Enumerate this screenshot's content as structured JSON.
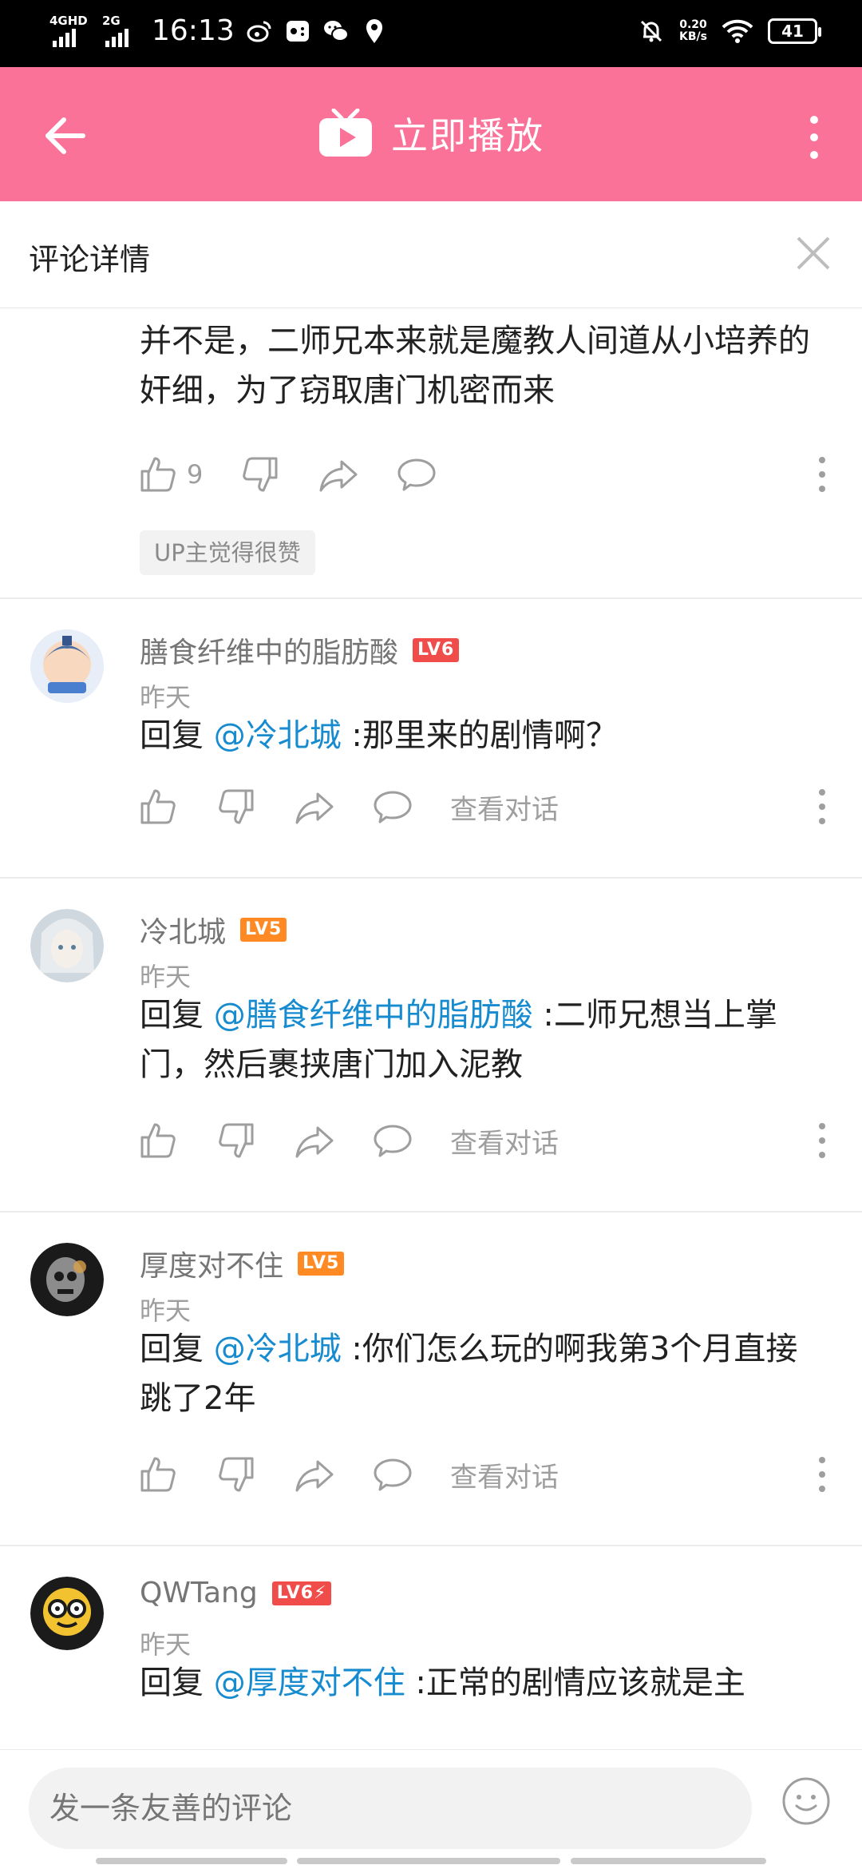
{
  "status_bar": {
    "sim1": "4GHD",
    "sim2": "2G",
    "time": "16:13",
    "net_speed_value": "0.20",
    "net_speed_unit": "KB/s",
    "battery": "41"
  },
  "header": {
    "title": "立即播放",
    "accent_color": "#fb7299"
  },
  "section": {
    "title": "评论详情"
  },
  "comments": [
    {
      "text": "并不是，二师兄本来就是魔教人间道从小培养的奸细，为了窃取唐门机密而来",
      "likes": "9",
      "up_tag": "UP主觉得很赞"
    },
    {
      "username": "膳食纤维中的脂肪酸",
      "level": "LV6",
      "level_color": "#f04c49",
      "time": "昨天",
      "reply_prefix": "回复 ",
      "mention": "@冷北城",
      "text": " :那里来的剧情啊？",
      "view_conversation": "查看对话"
    },
    {
      "username": "冷北城",
      "level": "LV5",
      "level_color": "#ff8a24",
      "time": "昨天",
      "reply_prefix": "回复 ",
      "mention": "@膳食纤维中的脂肪酸",
      "text": " :二师兄想当上掌门，然后裹挟唐门加入泥教",
      "view_conversation": "查看对话"
    },
    {
      "username": "厚度对不住",
      "level": "LV5",
      "level_color": "#ff8a24",
      "time": "昨天",
      "reply_prefix": "回复 ",
      "mention": "@冷北城",
      "text": " :你们怎么玩的啊我第3个月直接跳了2年",
      "view_conversation": "查看对话"
    },
    {
      "username": "QWTang",
      "level": "LV6⚡",
      "level_color": "#f04c49",
      "time": "昨天",
      "reply_prefix": "回复 ",
      "mention": "@厚度对不住",
      "text": " :正常的剧情应该就是主"
    }
  ],
  "composer": {
    "placeholder": "发一条友善的评论"
  }
}
